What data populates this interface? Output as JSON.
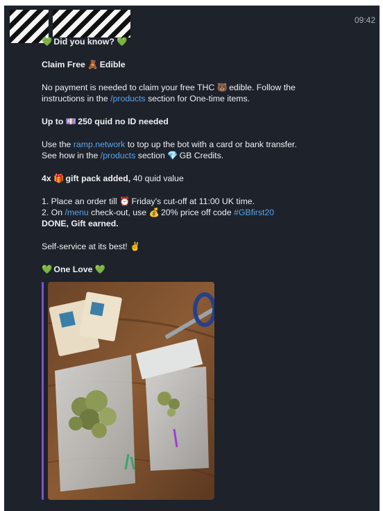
{
  "header": {
    "time": "09:42"
  },
  "message": {
    "did_you_know": "Did you know?",
    "claim_pre": "Claim Free",
    "claim_post": "Edible",
    "no_payment_1a": "No payment is needed to claim your free THC",
    "no_payment_1b": "edible. Follow the",
    "no_payment_2a": "instructions in the",
    "products_link": "/products",
    "no_payment_2b": "section for One-time items.",
    "upto_pre": "Up to",
    "upto_post": "250 quid no ID needed",
    "ramp_1a": "Use the",
    "ramp_link": "ramp.network",
    "ramp_1b": "to top up the bot with a card or bank transfer.",
    "ramp_2a": "See how in the",
    "ramp_2b": "section",
    "ramp_2c": "GB Credits.",
    "gift_pre": "4x",
    "gift_bold": "gift pack added,",
    "gift_post": "40 quid value",
    "step1a": "1. Place an order till",
    "step1b": "Friday's cut-off at 11:00 UK time.",
    "step2a": "2. On",
    "menu_link": "/menu",
    "step2b": "check-out, use",
    "step2c": "20% price off code",
    "code_link": "#GBfirst20",
    "done": "DONE, Gift earned.",
    "self_service": "Self-service at its best!",
    "one_love": "One Love"
  },
  "icons": {
    "heart": "💚",
    "bear": "🧸",
    "bear2": "🐻",
    "cash": "💷",
    "gift": "🎁",
    "clock": "⏰",
    "moneybag": "💰",
    "gem": "💎",
    "victory": "✌"
  },
  "colors": {
    "background": "#1d222b",
    "link": "#5aa6ea",
    "accent_bar": "#7b53c9"
  }
}
